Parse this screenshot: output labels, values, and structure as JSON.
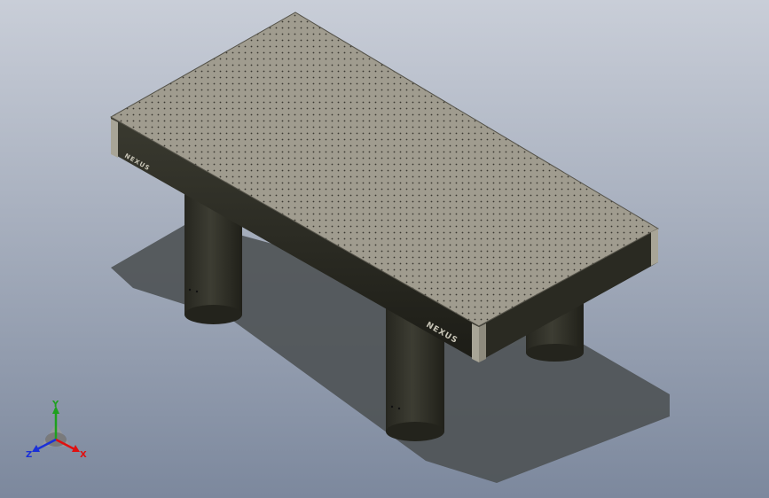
{
  "viewport": {
    "background_top": "#c7ccd6",
    "background_bottom": "#7f8ba0",
    "table_top_color": "#9d998c",
    "table_edge_color": "#2b2b22",
    "leg_color": "#2f2f28",
    "shadow_color": "#505456"
  },
  "model": {
    "brand_front": "NEXUS",
    "brand_side": "NEXUS"
  },
  "triad": {
    "x_label": "X",
    "y_label": "Y",
    "z_label": "Z",
    "x_color": "#e01010",
    "y_color": "#1ea01e",
    "z_color": "#1a30d8"
  }
}
